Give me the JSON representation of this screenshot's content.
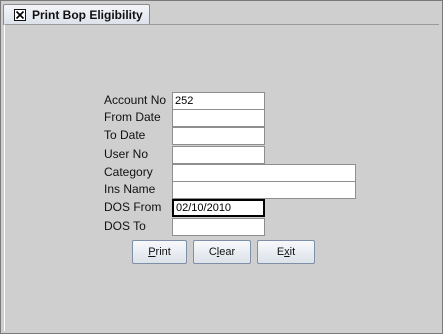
{
  "tab": {
    "title": "Print Bop Eligibility",
    "close_icon": "close-icon"
  },
  "form": {
    "account_no": {
      "label": "Account No",
      "value": "252"
    },
    "from_date": {
      "label": "From Date",
      "value": ""
    },
    "to_date": {
      "label": "To Date",
      "value": ""
    },
    "user_no": {
      "label": "User No",
      "value": ""
    },
    "category": {
      "label": "Category",
      "value": ""
    },
    "ins_name": {
      "label": "Ins Name",
      "value": ""
    },
    "dos_from": {
      "label": "DOS From",
      "value": "02/10/2010"
    },
    "dos_to": {
      "label": "DOS To",
      "value": ""
    }
  },
  "buttons": {
    "print": {
      "mnemonic": "P",
      "rest": "rint"
    },
    "clear": {
      "pre": "C",
      "mnemonic": "l",
      "rest": "ear"
    },
    "exit": {
      "pre": "E",
      "mnemonic": "x",
      "rest": "it"
    }
  }
}
